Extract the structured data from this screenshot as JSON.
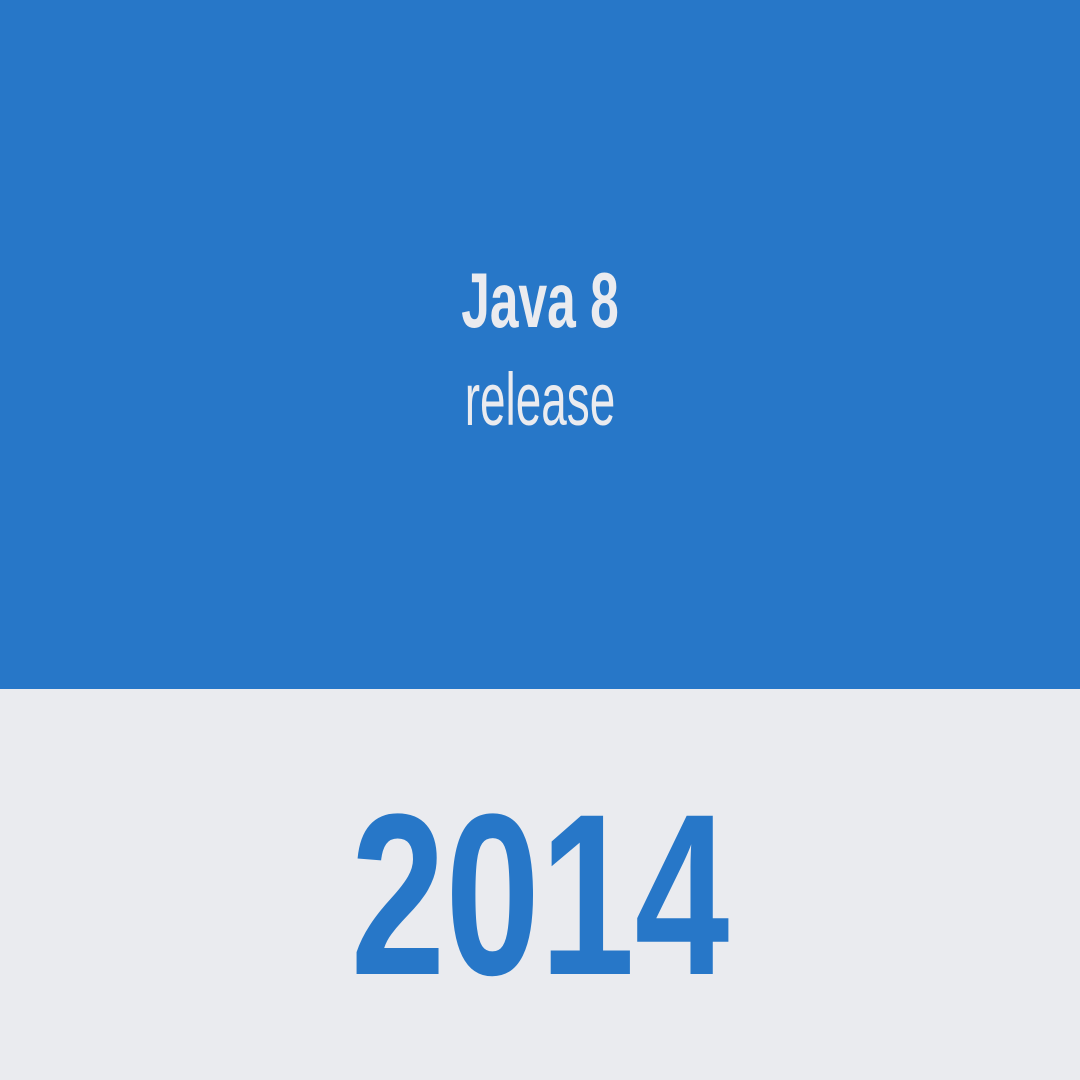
{
  "card": {
    "title": "Java 8",
    "subtitle": "release",
    "year": "2014"
  },
  "colors": {
    "primary_blue": "#2777C8",
    "light_gray": "#EAEBEF"
  }
}
